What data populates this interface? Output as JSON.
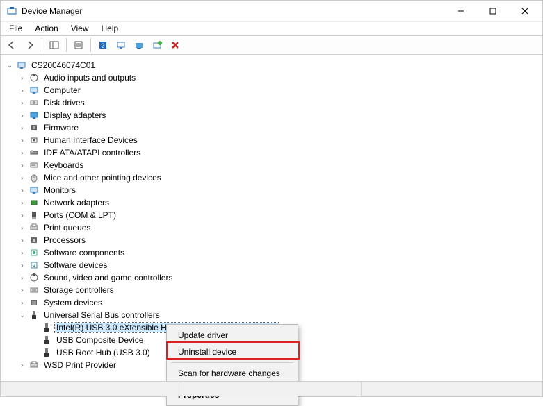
{
  "window": {
    "title": "Device Manager"
  },
  "menubar": [
    "File",
    "Action",
    "View",
    "Help"
  ],
  "tree": {
    "root": "CS20046074C01",
    "categories": [
      "Audio inputs and outputs",
      "Computer",
      "Disk drives",
      "Display adapters",
      "Firmware",
      "Human Interface Devices",
      "IDE ATA/ATAPI controllers",
      "Keyboards",
      "Mice and other pointing devices",
      "Monitors",
      "Network adapters",
      "Ports (COM & LPT)",
      "Print queues",
      "Processors",
      "Software components",
      "Software devices",
      "Sound, video and game controllers",
      "Storage controllers",
      "System devices"
    ],
    "usb": {
      "label": "Universal Serial Bus controllers",
      "children": [
        "Intel(R) USB 3.0 eXtensible Host Controller - 1.0 (Microsoft)",
        "USB Composite Device",
        "USB Root Hub (USB 3.0)"
      ]
    },
    "last": "WSD Print Provider"
  },
  "context_menu": {
    "update": "Update driver",
    "uninstall": "Uninstall device",
    "scan": "Scan for hardware changes",
    "properties": "Properties"
  }
}
